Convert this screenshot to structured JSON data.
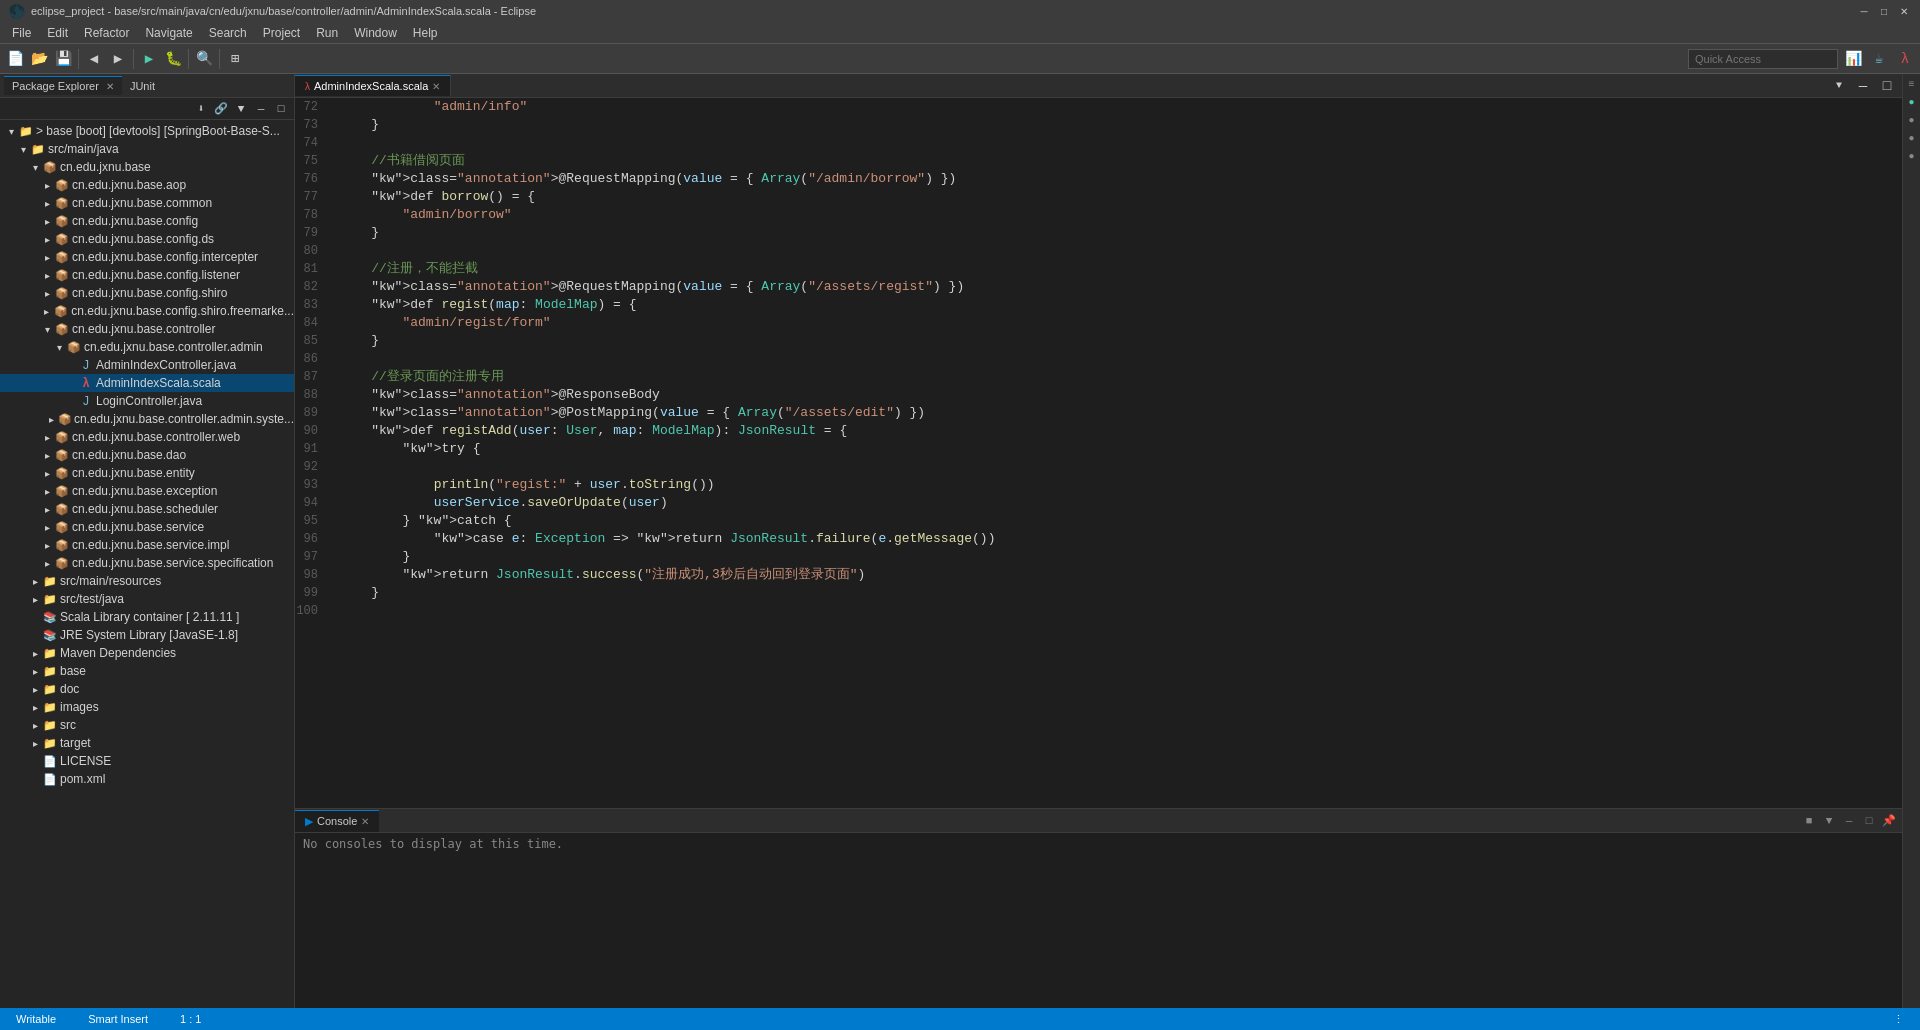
{
  "titleBar": {
    "title": "eclipse_project - base/src/main/java/cn/edu/jxnu/base/controller/admin/AdminIndexScala.scala - Eclipse",
    "iconAlt": "eclipse-icon",
    "minLabel": "─",
    "maxLabel": "□",
    "closeLabel": "✕"
  },
  "menuBar": {
    "items": [
      "File",
      "Edit",
      "Refactor",
      "Navigate",
      "Search",
      "Project",
      "Run",
      "Window",
      "Help"
    ]
  },
  "quickAccess": {
    "placeholder": "Quick Access",
    "label": "Quick Access"
  },
  "packageExplorer": {
    "tabLabel": "Package Explorer",
    "closeLabel": "✕",
    "junitLabel": "JUnit",
    "tree": [
      {
        "indent": 0,
        "arrow": "▾",
        "icon": "📁",
        "label": "> base [boot] [devtools] [SpringBoot-Base-S..."
      },
      {
        "indent": 1,
        "arrow": "▾",
        "icon": "📁",
        "label": "src/main/java"
      },
      {
        "indent": 2,
        "arrow": "▾",
        "icon": "📦",
        "label": "cn.edu.jxnu.base"
      },
      {
        "indent": 3,
        "arrow": "▸",
        "icon": "📦",
        "label": "cn.edu.jxnu.base.aop"
      },
      {
        "indent": 3,
        "arrow": "▸",
        "icon": "📦",
        "label": "cn.edu.jxnu.base.common"
      },
      {
        "indent": 3,
        "arrow": "▸",
        "icon": "📦",
        "label": "cn.edu.jxnu.base.config"
      },
      {
        "indent": 3,
        "arrow": "▸",
        "icon": "📦",
        "label": "cn.edu.jxnu.base.config.ds"
      },
      {
        "indent": 3,
        "arrow": "▸",
        "icon": "📦",
        "label": "cn.edu.jxnu.base.config.intercepter"
      },
      {
        "indent": 3,
        "arrow": "▸",
        "icon": "📦",
        "label": "cn.edu.jxnu.base.config.listener"
      },
      {
        "indent": 3,
        "arrow": "▸",
        "icon": "📦",
        "label": "cn.edu.jxnu.base.config.shiro"
      },
      {
        "indent": 3,
        "arrow": "▸",
        "icon": "📦",
        "label": "cn.edu.jxnu.base.config.shiro.freemarke..."
      },
      {
        "indent": 3,
        "arrow": "▾",
        "icon": "📦",
        "label": "cn.edu.jxnu.base.controller"
      },
      {
        "indent": 4,
        "arrow": "▾",
        "icon": "📦",
        "label": "cn.edu.jxnu.base.controller.admin"
      },
      {
        "indent": 5,
        "arrow": "",
        "icon": "☕",
        "label": "AdminIndexController.java",
        "isJava": true
      },
      {
        "indent": 5,
        "arrow": "",
        "icon": "λ",
        "label": "AdminIndexScala.scala",
        "isScala": true,
        "selected": true
      },
      {
        "indent": 5,
        "arrow": "",
        "icon": "☕",
        "label": "LoginController.java",
        "isJava": true
      },
      {
        "indent": 4,
        "arrow": "▸",
        "icon": "📦",
        "label": "cn.edu.jxnu.base.controller.admin.syste..."
      },
      {
        "indent": 3,
        "arrow": "▸",
        "icon": "📦",
        "label": "cn.edu.jxnu.base.controller.web"
      },
      {
        "indent": 3,
        "arrow": "▸",
        "icon": "📦",
        "label": "cn.edu.jxnu.base.dao"
      },
      {
        "indent": 3,
        "arrow": "▸",
        "icon": "📦",
        "label": "cn.edu.jxnu.base.entity"
      },
      {
        "indent": 3,
        "arrow": "▸",
        "icon": "📦",
        "label": "cn.edu.jxnu.base.exception"
      },
      {
        "indent": 3,
        "arrow": "▸",
        "icon": "📦",
        "label": "cn.edu.jxnu.base.scheduler"
      },
      {
        "indent": 3,
        "arrow": "▸",
        "icon": "📦",
        "label": "cn.edu.jxnu.base.service"
      },
      {
        "indent": 3,
        "arrow": "▸",
        "icon": "📦",
        "label": "cn.edu.jxnu.base.service.impl"
      },
      {
        "indent": 3,
        "arrow": "▸",
        "icon": "📦",
        "label": "cn.edu.jxnu.base.service.specification"
      },
      {
        "indent": 2,
        "arrow": "▸",
        "icon": "📁",
        "label": "src/main/resources"
      },
      {
        "indent": 2,
        "arrow": "▸",
        "icon": "📁",
        "label": "src/test/java"
      },
      {
        "indent": 2,
        "arrow": "",
        "icon": "📚",
        "label": "Scala Library container [ 2.11.11 ]"
      },
      {
        "indent": 2,
        "arrow": "",
        "icon": "📚",
        "label": "JRE System Library [JavaSE-1.8]"
      },
      {
        "indent": 2,
        "arrow": "▸",
        "icon": "📁",
        "label": "Maven Dependencies"
      },
      {
        "indent": 2,
        "arrow": "▸",
        "icon": "📁",
        "label": "base"
      },
      {
        "indent": 2,
        "arrow": "▸",
        "icon": "📁",
        "label": "doc"
      },
      {
        "indent": 2,
        "arrow": "▸",
        "icon": "📁",
        "label": "images"
      },
      {
        "indent": 2,
        "arrow": "▸",
        "icon": "📁",
        "label": "src"
      },
      {
        "indent": 2,
        "arrow": "▸",
        "icon": "📁",
        "label": "target"
      },
      {
        "indent": 2,
        "arrow": "",
        "icon": "📄",
        "label": "LICENSE"
      },
      {
        "indent": 2,
        "arrow": "",
        "icon": "📄",
        "label": "pom.xml"
      }
    ]
  },
  "editorTab": {
    "label": "AdminIndexScala.scala",
    "closeLabel": "✕",
    "maxLabel": "□",
    "restoreLabel": "❐"
  },
  "codeLines": [
    {
      "num": 72,
      "hasDot": false,
      "content": "            \"admin/info\""
    },
    {
      "num": 73,
      "hasDot": false,
      "content": "    }"
    },
    {
      "num": 74,
      "hasDot": false,
      "content": ""
    },
    {
      "num": 75,
      "hasDot": false,
      "content": "    //书籍借阅页面"
    },
    {
      "num": 76,
      "hasDot": true,
      "content": "    @RequestMapping(value = { Array(\"/admin/borrow\") })"
    },
    {
      "num": 77,
      "hasDot": false,
      "content": "    def borrow() = {"
    },
    {
      "num": 78,
      "hasDot": false,
      "content": "        \"admin/borrow\""
    },
    {
      "num": 79,
      "hasDot": false,
      "content": "    }"
    },
    {
      "num": 80,
      "hasDot": false,
      "content": ""
    },
    {
      "num": 81,
      "hasDot": false,
      "content": "    //注册，不能拦截"
    },
    {
      "num": 82,
      "hasDot": true,
      "content": "    @RequestMapping(value = { Array(\"/assets/regist\") })"
    },
    {
      "num": 83,
      "hasDot": false,
      "content": "    def regist(map: ModelMap) = {"
    },
    {
      "num": 84,
      "hasDot": false,
      "content": "        \"admin/regist/form\""
    },
    {
      "num": 85,
      "hasDot": false,
      "content": "    }"
    },
    {
      "num": 86,
      "hasDot": false,
      "content": ""
    },
    {
      "num": 87,
      "hasDot": false,
      "content": "    //登录页面的注册专用"
    },
    {
      "num": 88,
      "hasDot": false,
      "content": "    @ResponseBody"
    },
    {
      "num": 89,
      "hasDot": false,
      "content": "    @PostMapping(value = { Array(\"/assets/edit\") })"
    },
    {
      "num": 90,
      "hasDot": false,
      "content": "    def registAdd(user: User, map: ModelMap): JsonResult = {"
    },
    {
      "num": 91,
      "hasDot": false,
      "content": "        try {"
    },
    {
      "num": 92,
      "hasDot": false,
      "content": ""
    },
    {
      "num": 93,
      "hasDot": false,
      "content": "            println(\"regist:\" + user.toString())"
    },
    {
      "num": 94,
      "hasDot": false,
      "content": "            userService.saveOrUpdate(user)"
    },
    {
      "num": 95,
      "hasDot": false,
      "content": "        } catch {"
    },
    {
      "num": 96,
      "hasDot": false,
      "content": "            case e: Exception => return JsonResult.failure(e.getMessage())"
    },
    {
      "num": 97,
      "hasDot": false,
      "content": "        }"
    },
    {
      "num": 98,
      "hasDot": false,
      "content": "        return JsonResult.success(\"注册成功,3秒后自动回到登录页面\")"
    },
    {
      "num": 99,
      "hasDot": false,
      "content": "    }"
    },
    {
      "num": 100,
      "hasDot": false,
      "content": ""
    }
  ],
  "bottomPanel": {
    "tabLabel": "Console",
    "closeLabel": "✕",
    "consoleMessage": "No consoles to display at this time."
  },
  "statusBar": {
    "writable": "Writable",
    "smartInsert": "Smart Insert",
    "position": "1 : 1",
    "moreLabel": "⋮"
  }
}
